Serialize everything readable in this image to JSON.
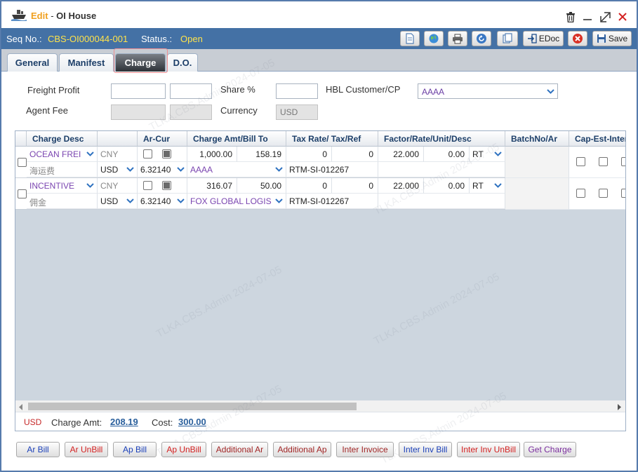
{
  "titlebar": {
    "mode": "Edit",
    "separator": "-",
    "name": "OI House"
  },
  "infobar": {
    "seq_label": "Seq No.:",
    "seq_value": "CBS-OI000044-001",
    "status_label": "Status.:",
    "status_value": "Open",
    "toolbar": {
      "edoc_label": "EDoc",
      "save_label": "Save"
    }
  },
  "tabs": [
    {
      "label": "General"
    },
    {
      "label": "Manifest"
    },
    {
      "label": "Charge"
    },
    {
      "label": "D.O."
    }
  ],
  "form": {
    "freight_profit_label": "Freight Profit",
    "share_label": "Share %",
    "hbl_customer_label": "HBL Customer/CP",
    "hbl_customer_value": "AAAA",
    "agent_fee_label": "Agent Fee",
    "currency_label": "Currency",
    "currency_value": "USD"
  },
  "grid": {
    "columns": [
      "Charge Desc",
      "Ar-Cur",
      "Charge Amt/Bill To",
      "Tax Rate/ Tax/Ref",
      "Factor/Rate/Unit/Desc",
      "BatchNo/Ar",
      "Cap-Est-Inter"
    ],
    "rows": [
      {
        "charge": "OCEAN FREI",
        "local_name": "海运费",
        "ar_cur": "CNY",
        "bill_cur": "USD",
        "rate": "6.32140",
        "amount": "1,000.00",
        "bill_amount": "158.19",
        "bill_to": "AAAA",
        "tax_rate": "0",
        "tax": "0",
        "ref": "RTM-SI-012267",
        "factor": "22.000",
        "unit_rate": "0.00",
        "unit": "RT"
      },
      {
        "charge": "INCENTIVE",
        "local_name": "佣金",
        "ar_cur": "CNY",
        "bill_cur": "USD",
        "rate": "6.32140",
        "amount": "316.07",
        "bill_amount": "50.00",
        "bill_to": "FOX GLOBAL LOGIS",
        "tax_rate": "0",
        "tax": "0",
        "ref": "RTM-SI-012267",
        "factor": "22.000",
        "unit_rate": "0.00",
        "unit": "RT"
      }
    ],
    "footer": {
      "currency": "USD",
      "charge_amt_label": "Charge Amt:",
      "charge_amt_value": "208.19",
      "cost_label": "Cost:",
      "cost_value": "300.00"
    }
  },
  "bottom_buttons": [
    {
      "label": "Ar Bill"
    },
    {
      "label": "Ar UnBill"
    },
    {
      "label": "Ap Bill"
    },
    {
      "label": "Ap UnBill"
    },
    {
      "label": "Additional Ar"
    },
    {
      "label": "Additional Ap"
    },
    {
      "label": "Inter Invoice"
    },
    {
      "label": "Inter Inv Bill"
    },
    {
      "label": "Inter Inv UnBill"
    },
    {
      "label": "Get Charge"
    }
  ],
  "watermark": "TLKA.CBS.Admin 2024-07-05",
  "colors": {
    "header_blue": "#4471a5",
    "status_yellow": "#ffe34a",
    "edit_orange": "#f0a020",
    "link_blue": "#2a5f9c"
  }
}
